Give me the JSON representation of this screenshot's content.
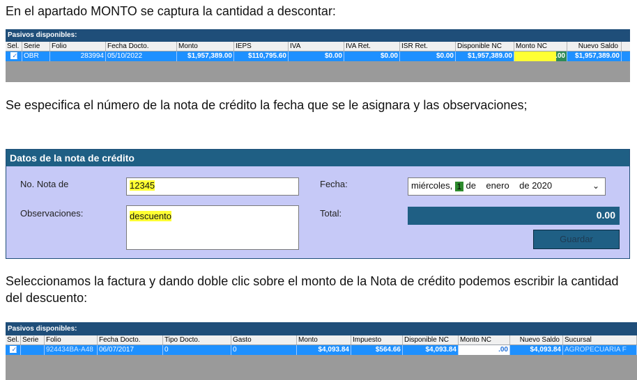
{
  "paragraphs": {
    "p1": "En el apartado MONTO se captura la cantidad a descontar:",
    "p2": "Se especifica el número de la nota de crédito la fecha que se le asignara y las observaciones;",
    "p3": "Seleccionamos la factura y dando doble clic sobre el monto de la Nota de crédito podemos escribir la cantidad del descuento:"
  },
  "grid1": {
    "title": "Pasivos disponibles:",
    "headers": [
      "Sel.",
      "Serie",
      "Folio",
      "Fecha Docto.",
      "Monto",
      "IEPS",
      "IVA",
      "IVA Ret.",
      "ISR Ret.",
      "Disponible NC",
      "Monto NC",
      "Nuevo Saldo"
    ],
    "row": {
      "checked": "✓",
      "serie": "OBR",
      "folio": "283994",
      "fecha": "05/10/2022",
      "monto": "$1,957,389.00",
      "ieps": "$110,795.60",
      "iva": "$0.00",
      "iva_ret": "$0.00",
      "isr_ret": "$0.00",
      "disponible_nc": "$1,957,389.00",
      "monto_nc": ".00",
      "nuevo_saldo": "$1,957,389.00"
    }
  },
  "form": {
    "title": "Datos de la nota de crédito",
    "no_nota_label": "No. Nota de",
    "no_nota_value": "12345",
    "fecha_label": "Fecha:",
    "fecha_weekday": "miércoles,",
    "fecha_day": "1",
    "fecha_de1": "de",
    "fecha_month": "enero",
    "fecha_year": "de 2020",
    "observaciones_label": "Observaciones:",
    "observaciones_value": "descuento",
    "total_label": "Total:",
    "total_value": "0.00",
    "guardar_label": "Guardar"
  },
  "grid2": {
    "title": "Pasivos disponibles:",
    "headers": [
      "Sel.",
      "Serie",
      "Folio",
      "Fecha Docto.",
      "Tipo Docto.",
      "Gasto",
      "Monto",
      "Impuesto",
      "Disponible NC",
      "Monto NC",
      "Nuevo Saldo",
      "Sucursal"
    ],
    "row": {
      "checked": "✓",
      "serie": "",
      "folio": "924434BA-A48",
      "fecha": "06/07/2017",
      "tipo": "0",
      "gasto": "0",
      "monto": "$4,093.84",
      "impuesto": "$564.66",
      "disponible_nc": "$4,093.84",
      "monto_nc": ".00",
      "nuevo_saldo": "$4,093.84",
      "sucursal": "AGROPECUARIA F"
    }
  }
}
